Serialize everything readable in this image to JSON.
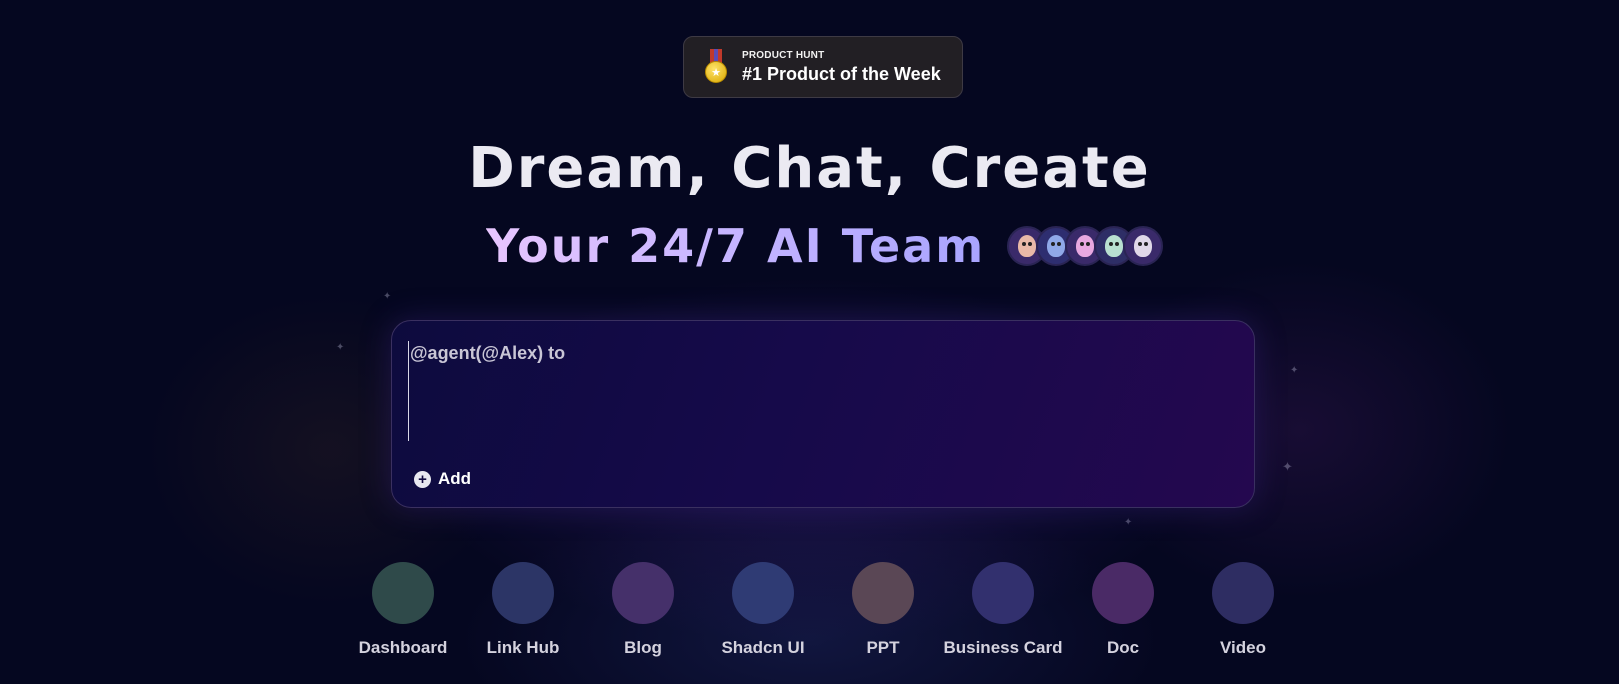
{
  "badge": {
    "kicker": "PRODUCT HUNT",
    "title": "#1 Product of the Week",
    "icon": "medal-icon"
  },
  "hero": {
    "title": "Dream, Chat, Create",
    "subtitle": "Your 24/7 AI Team",
    "avatar_colors": [
      "#e8b9a8",
      "#8fa8e8",
      "#e8a8e0",
      "#b8e0d0",
      "#e0d8e8"
    ]
  },
  "composer": {
    "placeholder": "@agent(@Alex) to",
    "add_label": "Add"
  },
  "templates": [
    {
      "label": "Dashboard",
      "color": "#2f4a4a"
    },
    {
      "label": "Link Hub",
      "color": "#2c3566"
    },
    {
      "label": "Blog",
      "color": "#45306a"
    },
    {
      "label": "Shadcn UI",
      "color": "#2f3b74"
    },
    {
      "label": "PPT",
      "color": "#5a4755"
    },
    {
      "label": "Business Card",
      "color": "#32306e"
    },
    {
      "label": "Doc",
      "color": "#4a2a66"
    },
    {
      "label": "Video",
      "color": "#2e2d62"
    }
  ],
  "colors": {
    "background": "#050720",
    "accent": "#a8a4ff"
  }
}
